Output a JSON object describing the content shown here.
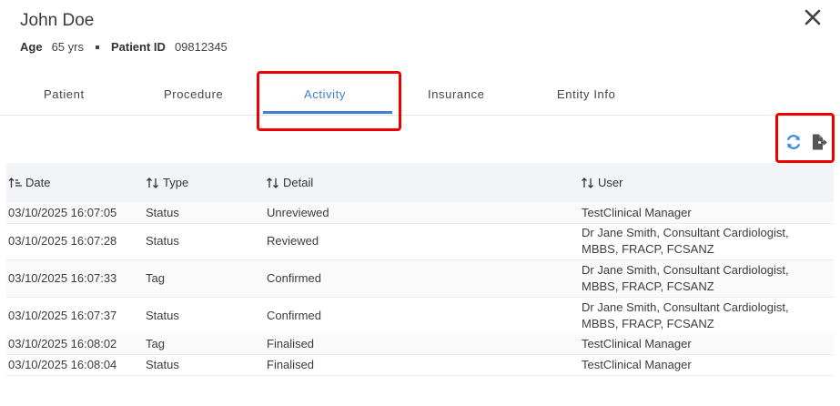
{
  "patient": {
    "name": "John Doe",
    "age_label": "Age",
    "age_value": "65 yrs",
    "id_label": "Patient ID",
    "id_value": "09812345"
  },
  "tabs": [
    {
      "label": "Patient"
    },
    {
      "label": "Procedure"
    },
    {
      "label": "Activity"
    },
    {
      "label": "Insurance"
    },
    {
      "label": "Entity Info"
    }
  ],
  "active_tab": "Activity",
  "toolbar": {
    "refresh_icon": "refresh-icon",
    "export_icon": "export-file-icon"
  },
  "table": {
    "columns": [
      "Date",
      "Type",
      "Detail",
      "User"
    ],
    "rows": [
      {
        "date": "03/10/2025 16:07:05",
        "type": "Status",
        "detail": "Unreviewed",
        "user1": "TestClinical Manager",
        "user2": ""
      },
      {
        "date": "03/10/2025 16:07:28",
        "type": "Status",
        "detail": "Reviewed",
        "user1": "Dr Jane Smith, Consultant Cardiologist,",
        "user2": "MBBS, FRACP, FCSANZ"
      },
      {
        "date": "03/10/2025 16:07:33",
        "type": "Tag",
        "detail": "Confirmed",
        "user1": "Dr Jane Smith, Consultant Cardiologist,",
        "user2": "MBBS, FRACP, FCSANZ"
      },
      {
        "date": "03/10/2025 16:07:37",
        "type": "Status",
        "detail": "Confirmed",
        "user1": "Dr Jane Smith, Consultant Cardiologist,",
        "user2": "MBBS, FRACP, FCSANZ"
      },
      {
        "date": "03/10/2025 16:08:02",
        "type": "Tag",
        "detail": "Finalised",
        "user1": "TestClinical Manager",
        "user2": ""
      },
      {
        "date": "03/10/2025 16:08:04",
        "type": "Status",
        "detail": "Finalised",
        "user1": "TestClinical Manager",
        "user2": ""
      }
    ]
  },
  "colors": {
    "accent": "#3d7fd6",
    "highlight": "#ee0000"
  }
}
